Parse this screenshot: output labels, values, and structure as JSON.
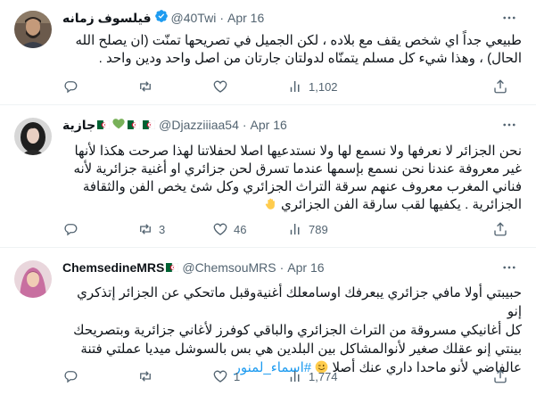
{
  "tweets": [
    {
      "name": "فيلسوف زمانه",
      "verified": true,
      "handle": "@40Twi",
      "separator": "·",
      "date": "Apr 16",
      "lines": [
        "طبيعي جداً اي شخص يقف مع بلاده ، لكن الجميل في تصريحها تمنّت (ان يصلح الله",
        "الحال) ، وهذا شيء كل مسلم يتمنّاه لدولتان جارتان من اصل واحد ودين واحد ."
      ],
      "replies": "",
      "retweets": "",
      "likes": "",
      "views": "1,102"
    },
    {
      "name": "جازية",
      "name_emojis": [
        "algeria-flag",
        "green-heart",
        "algeria-flag",
        "algeria-flag"
      ],
      "handle": "@Djazziiiaa54",
      "separator": "·",
      "date": "Apr 16",
      "lines": [
        "نحن الجزائر لا نعرفها ولا نسمع لها ولا نستدعيها اصلا لحفلاتنا لهذا صرحت هكذا لأنها",
        "غير معروفة عندنا نحن نسمع بإسمها عندما تسرق لحن جزائري او أغنية جزائرية لأنه",
        "فناني المغرب معروف عنهم سرقة التراث الجزائري وكل شئ يخص الفن والثقافة",
        "الجزائرية . يكفيها لقب سارقة الفن الجزائري"
      ],
      "line_emoji": "waving-hand",
      "replies": "",
      "retweets": "3",
      "likes": "46",
      "views": "789"
    },
    {
      "name": "ChemsedineMRS",
      "name_emojis": [
        "algeria-flag"
      ],
      "handle": "@ChemsouMRS",
      "separator": "·",
      "date": "Apr 16",
      "lines": [
        "حبيبتي أولا مافي جزائري يبعرفك اوسامعلك أغنيةوقبل ماتحكي عن الجزائر إتذكري إنو",
        "كل أغانيكي مسروقة من التراث الجزائري والباقي كوفرز لأغاني جزائرية وبتصريحك",
        "بينتي إنو عقلك صغير لأنوالمشاكل بين البلدين هي بس بالسوشل ميديا عملتي فتنة",
        "عالفاضي لأنو ماحدا داري عنك أصلا"
      ],
      "hashtag": "#اسماء_لمنور",
      "line_emoji": "winking-face",
      "replies": "",
      "retweets": "",
      "likes": "1",
      "views": "1,774"
    }
  ],
  "colors": {
    "text": "#0f1419",
    "secondary": "#536471",
    "link": "#1d9bf0",
    "verified": "#1d9bf0",
    "divider": "#eff3f4"
  },
  "icons": [
    "reply-icon",
    "retweet-icon",
    "like-icon",
    "views-icon",
    "share-icon",
    "more-icon",
    "verified-badge-icon"
  ]
}
